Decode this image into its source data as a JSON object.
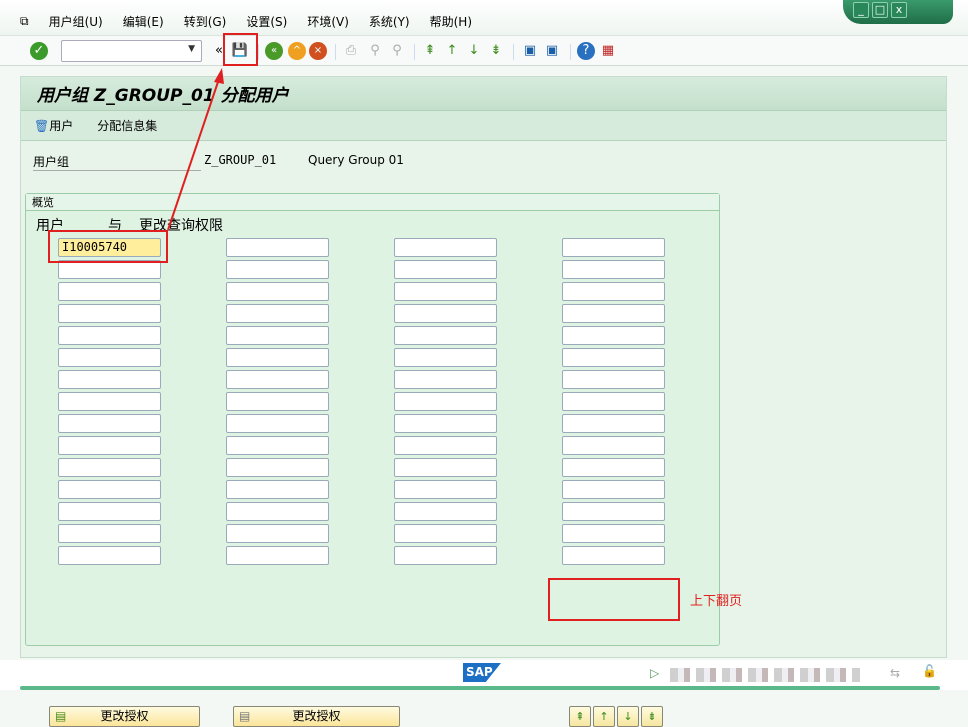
{
  "menu": [
    "用户组(U)",
    "编辑(E)",
    "转到(G)",
    "设置(S)",
    "环境(V)",
    "系统(Y)",
    "帮助(H)"
  ],
  "window_controls": {
    "minimize": "_",
    "maximize": "□",
    "close": "x"
  },
  "command_field": {
    "value": ""
  },
  "title": "用户组 Z_GROUP_01 分配用户",
  "subtoolbar": {
    "users": "用户",
    "assign_infoset": "分配信息集"
  },
  "user_group": {
    "label": "用户组",
    "value": "Z_GROUP_01",
    "description": "Query Group 01"
  },
  "overview": {
    "title": "概览",
    "col_user": "用户",
    "col_and": "与",
    "col_change": "更改查询权限",
    "grid": [
      [
        "I10005740",
        "",
        "",
        "",
        "",
        "",
        "",
        "",
        "",
        "",
        "",
        "",
        "",
        "",
        ""
      ],
      [
        "",
        "",
        "",
        "",
        "",
        "",
        "",
        "",
        "",
        "",
        "",
        "",
        "",
        "",
        ""
      ],
      [
        "",
        "",
        "",
        "",
        "",
        "",
        "",
        "",
        "",
        "",
        "",
        "",
        "",
        "",
        ""
      ],
      [
        "",
        "",
        "",
        "",
        "",
        "",
        "",
        "",
        "",
        "",
        "",
        "",
        "",
        "",
        ""
      ]
    ],
    "button1": "更改授权",
    "button2": "更改授权"
  },
  "annotation": "上下翻页",
  "status": {
    "logo": "SAP"
  },
  "colors": {
    "annotation": "#e02020",
    "panel": "#e8f4ea"
  }
}
